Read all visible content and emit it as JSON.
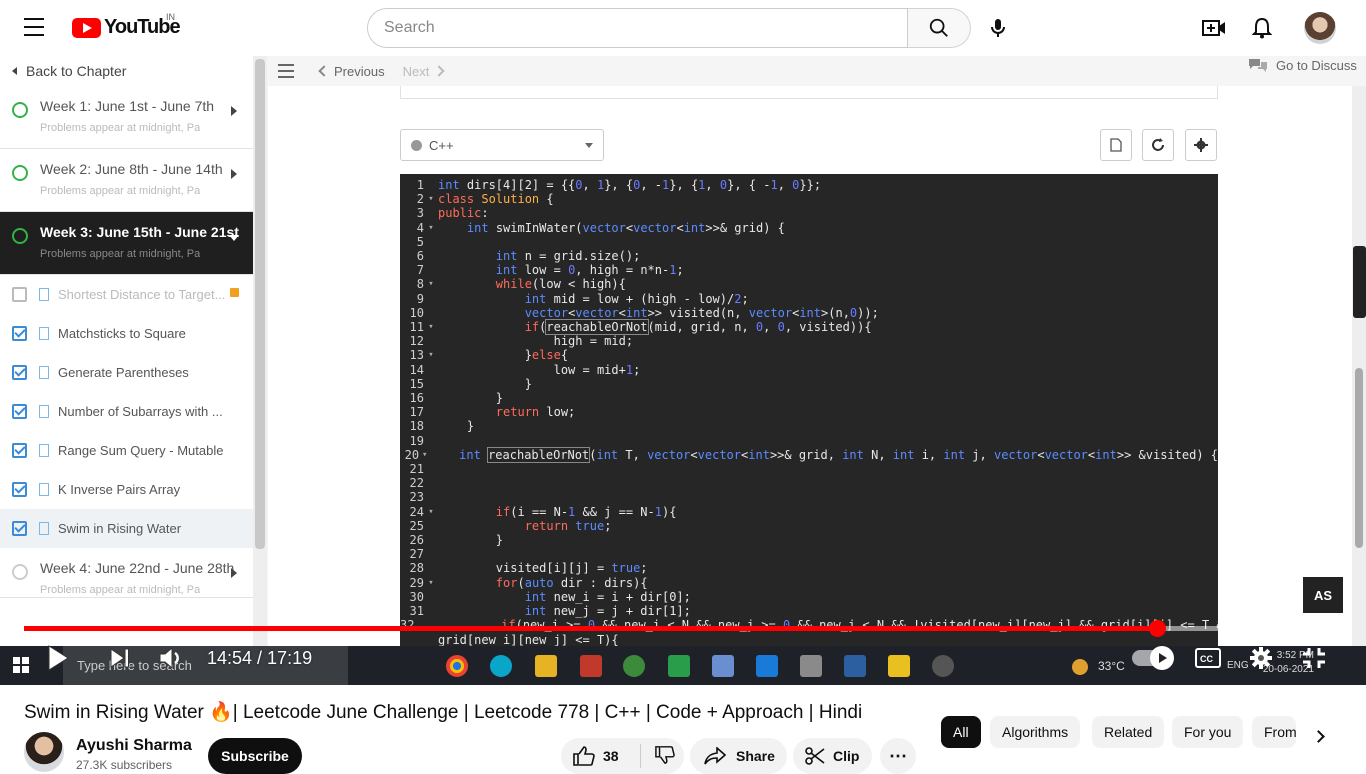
{
  "header": {
    "logo_text": "YouTube",
    "country_code": "IN",
    "search_placeholder": "Search"
  },
  "sidebar": {
    "back_label": "Back to Chapter",
    "weeks": [
      {
        "title": "Week 1: June 1st - June 7th",
        "sub": "Problems appear at midnight, Pa"
      },
      {
        "title": "Week 2: June 8th - June 14th",
        "sub": "Problems appear at midnight, Pa"
      },
      {
        "title": "Week 3: June 15th - June 21st",
        "sub": "Problems appear at midnight, Pa"
      },
      {
        "title": "Week 4: June 22nd - June 28th",
        "sub": "Problems appear at midnight, Pa"
      }
    ],
    "problems": [
      {
        "label": "Shortest Distance to Target...",
        "checked": false,
        "locked": true
      },
      {
        "label": "Matchsticks to Square",
        "checked": true
      },
      {
        "label": "Generate Parentheses",
        "checked": true
      },
      {
        "label": "Number of Subarrays with ...",
        "checked": true
      },
      {
        "label": "Range Sum Query - Mutable",
        "checked": true
      },
      {
        "label": "K Inverse Pairs Array",
        "checked": true
      },
      {
        "label": "Swim in Rising Water",
        "checked": true
      }
    ]
  },
  "toolbar": {
    "previous": "Previous",
    "next": "Next",
    "discuss": "Go to Discuss"
  },
  "editor": {
    "language": "C++",
    "lines": [
      "int dirs[4][2] = {{0, 1}, {0, -1}, {1, 0}, { -1, 0}};",
      "class Solution {",
      "public:",
      "    int swimInWater(vector<vector<int>>& grid) {",
      "",
      "        int n = grid.size();",
      "        int low = 0, high = n*n-1;",
      "        while(low < high){",
      "            int mid = low + (high - low)/2;",
      "            vector<vector<int>> visited(n, vector<int>(n,0));",
      "            if(reachableOrNot(mid, grid, n, 0, 0, visited)){",
      "                high = mid;",
      "            }else{",
      "                low = mid+1;",
      "            }",
      "        }",
      "        return low;",
      "    }",
      "",
      "    int reachableOrNot(int T, vector<vector<int>>& grid, int N, int i, int j, vector<vector<int>> &visited) {",
      "",
      "",
      "",
      "        if(i == N-1 && j == N-1){",
      "            return true;",
      "        }",
      "",
      "        visited[i][j] = true;",
      "        for(auto dir : dirs){",
      "            int new_i = i + dir[0];",
      "            int new_j = j + dir[1];",
      "            if(new_i >= 0 && new_i < N && new_j >= 0 && new_j < N && !visited[new_i][new_j] && grid[i][j] <= T &&",
      "grid[new_i][new_j] <= T){"
    ],
    "fold_lines": [
      2,
      4,
      8,
      11,
      13,
      20,
      24,
      29
    ]
  },
  "player": {
    "current_time": "14:54",
    "duration": "17:19",
    "time_display": "14:54 / 17:19",
    "progress": 0.86,
    "badge": "AS"
  },
  "taskbar": {
    "search_text": "Type here to search",
    "temperature": "33°C",
    "lang": "ENG",
    "time": "3:52 PM",
    "date": "20-06-2021"
  },
  "video": {
    "title": "Swim in Rising Water 🔥| Leetcode June Challenge | Leetcode 778 | C++ | Code + Approach | Hindi",
    "channel": "Ayushi Sharma",
    "subscribers": "27.3K subscribers",
    "subscribe_label": "Subscribe",
    "likes": "38",
    "share_label": "Share",
    "clip_label": "Clip"
  },
  "chips": [
    "All",
    "Algorithms",
    "Related",
    "For you",
    "From"
  ],
  "colors": {
    "brand_red": "#ff0000",
    "editor_bg": "#262626",
    "check_blue": "#3b8bd9",
    "progress_green": "#33b24a"
  }
}
